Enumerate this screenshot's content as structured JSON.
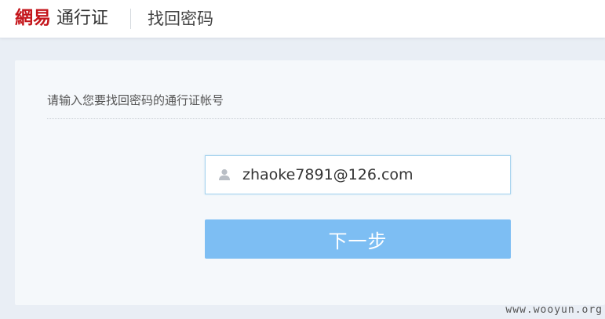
{
  "header": {
    "brand_logo": "網易",
    "brand_product": "通行证",
    "page_title": "找回密码"
  },
  "form": {
    "instruction": "请输入您要找回密码的通行证帐号",
    "account_value": "zhaoke7891@126.com",
    "account_icon": "user-icon",
    "next_label": "下一步"
  },
  "colors": {
    "brand_red": "#c4151b",
    "button_blue": "#7dbef3",
    "input_border": "#a9d4ee"
  },
  "watermark": "www.wooyun.org"
}
